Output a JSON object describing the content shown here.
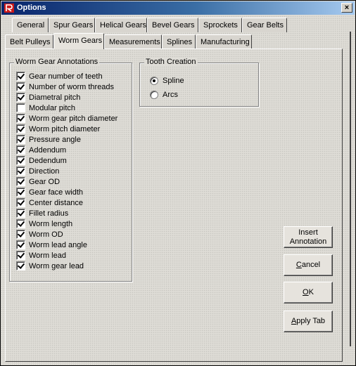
{
  "window": {
    "title": "Options",
    "close_glyph": "×",
    "icon": "app-logo-icon"
  },
  "tabs_row1": [
    {
      "label": "General"
    },
    {
      "label": "Spur Gears"
    },
    {
      "label": "Helical Gears"
    },
    {
      "label": "Bevel Gears"
    },
    {
      "label": "Sprockets"
    },
    {
      "label": "Gear Belts"
    }
  ],
  "tabs_row2": [
    {
      "label": "Belt Pulleys"
    },
    {
      "label": "Worm Gears"
    },
    {
      "label": "Measurements"
    },
    {
      "label": "Splines"
    },
    {
      "label": "Manufacturing"
    }
  ],
  "active_tab": "Worm Gears",
  "annotations": {
    "title": "Worm Gear Annotations",
    "items": [
      {
        "label": "Gear number of teeth",
        "checked": true
      },
      {
        "label": "Number of worm threads",
        "checked": true
      },
      {
        "label": "Diametral pitch",
        "checked": true
      },
      {
        "label": "Modular pitch",
        "checked": false
      },
      {
        "label": "Worm gear pitch diameter",
        "checked": true
      },
      {
        "label": "Worm pitch diameter",
        "checked": true
      },
      {
        "label": "Pressure angle",
        "checked": true
      },
      {
        "label": "Addendum",
        "checked": true
      },
      {
        "label": "Dedendum",
        "checked": true
      },
      {
        "label": "Direction",
        "checked": true
      },
      {
        "label": "Gear OD",
        "checked": true
      },
      {
        "label": "Gear face width",
        "checked": true
      },
      {
        "label": "Center distance",
        "checked": true
      },
      {
        "label": "Fillet radius",
        "checked": true
      },
      {
        "label": "Worm length",
        "checked": true
      },
      {
        "label": "Worm OD",
        "checked": true
      },
      {
        "label": "Worm lead angle",
        "checked": true
      },
      {
        "label": "Worm lead",
        "checked": true
      },
      {
        "label": "Worm gear lead",
        "checked": true
      }
    ]
  },
  "tooth_creation": {
    "title": "Tooth Creation",
    "options": [
      {
        "label": "Spline",
        "selected": true
      },
      {
        "label": "Arcs",
        "selected": false
      }
    ]
  },
  "buttons": {
    "insert_line1": "Insert",
    "insert_line2": "Annotation",
    "cancel_pre": "",
    "cancel_key": "C",
    "cancel_post": "ancel",
    "ok_pre": "",
    "ok_key": "O",
    "ok_post": "K",
    "apply_pre": "",
    "apply_key": "A",
    "apply_post": "pply Tab"
  },
  "colors": {
    "title_start": "#08246b",
    "title_end": "#a6caf0",
    "icon_red": "#cc1a1a"
  }
}
